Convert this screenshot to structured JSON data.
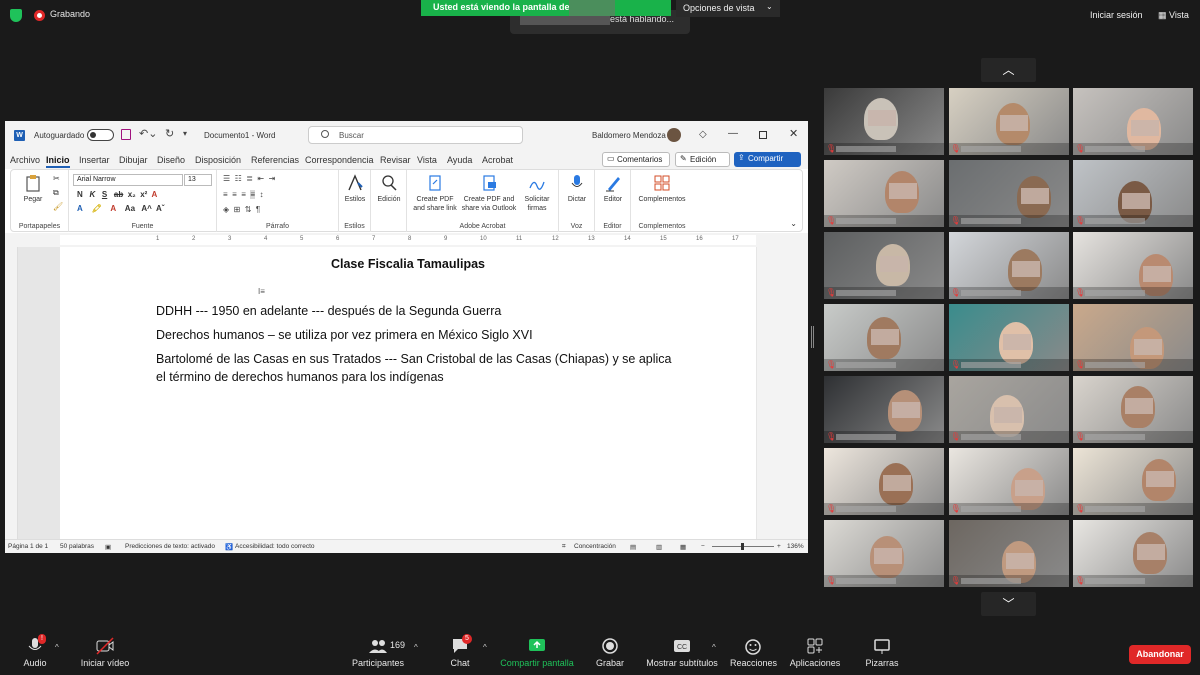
{
  "zoom_top": {
    "recording_label": "Grabando",
    "share_banner": "Usted está viendo la pantalla de",
    "talking_label": "está hablando...",
    "view_options": "Opciones de vista",
    "signin": "Iniciar sesión",
    "view": "Vista"
  },
  "word": {
    "autosave_label": "Autoguardado",
    "doc_title": "Documento1 - Word",
    "search_placeholder": "Buscar",
    "user_name": "Baldomero Mendoza",
    "tabs": [
      "Archivo",
      "Inicio",
      "Insertar",
      "Dibujar",
      "Diseño",
      "Disposición",
      "Referencias",
      "Correspondencia",
      "Revisar",
      "Vista",
      "Ayuda",
      "Acrobat"
    ],
    "btn_comments": "Comentarios",
    "btn_edit": "Edición",
    "btn_share": "Compartir",
    "font_name": "Arial Narrow",
    "font_size": "13",
    "ribbon": {
      "paste": "Pegar",
      "styles": "Estilos",
      "edit": "Edición",
      "create_pdf_link": "Create PDF and share link",
      "create_pdf_outlook": "Create PDF and share via Outlook",
      "signatures": "Solicitar firmas",
      "dictate": "Dictar",
      "editor": "Editor",
      "addins": "Complementos"
    },
    "groups": {
      "clipboard": "Portapapeles",
      "font": "Fuente",
      "paragraph": "Párrafo",
      "styles": "Estilos",
      "acrobat": "Adobe Acrobat",
      "voice": "Voz",
      "editor": "Editor",
      "addins": "Complementos"
    },
    "ruler_ticks": [
      "1",
      "2",
      "3",
      "4",
      "5",
      "6",
      "7",
      "8",
      "9",
      "10",
      "11",
      "12",
      "13",
      "14",
      "15",
      "16",
      "17"
    ],
    "doc": {
      "title": "Clase Fiscalia Tamaulipas",
      "lines": [
        "DDHH --- 1950 en adelante --- después de la Segunda Guerra",
        "Derechos humanos – se utiliza por vez primera en México Siglo XVI",
        "Bartolomé de las Casas en sus Tratados --- San Cristobal de las Casas (Chiapas) y se aplica",
        "el término de derechos humanos para los indígenas"
      ]
    },
    "status": {
      "page": "Página 1 de 1",
      "words": "50 palabras",
      "predictions": "Predicciones de texto: activado",
      "accessibility": "Accesibilidad: todo correcto",
      "focus": "Concentración",
      "zoom": "136%"
    }
  },
  "toolbar": {
    "audio": "Audio",
    "audio_badge": "!",
    "video": "Iniciar vídeo",
    "participants": "Participantes",
    "participants_count": "169",
    "chat": "Chat",
    "chat_badge": "5",
    "share": "Compartir pantalla",
    "record": "Grabar",
    "captions": "Mostrar subtítulos",
    "reactions": "Reacciones",
    "apps": "Aplicaciones",
    "whiteboards": "Pizarras",
    "leave": "Abandonar"
  },
  "tiles_count": 21
}
